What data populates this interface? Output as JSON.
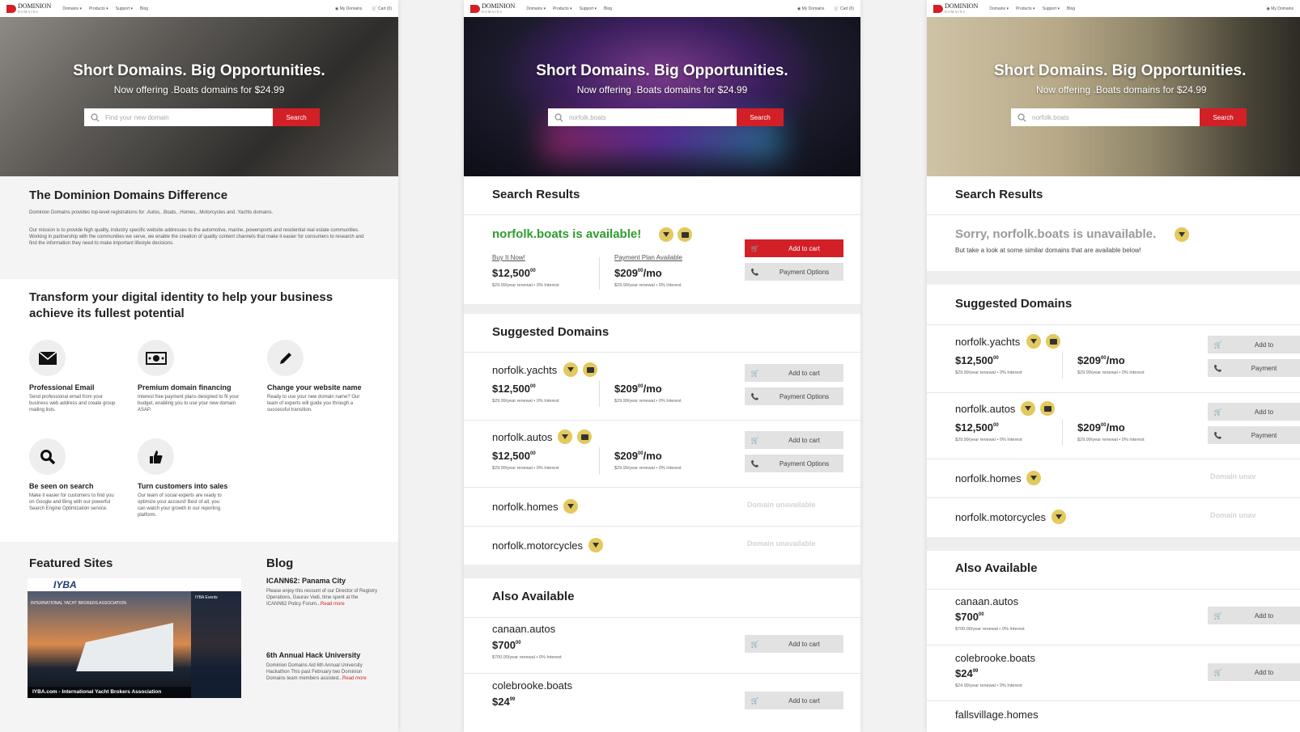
{
  "nav": {
    "brand": "DOMINION",
    "brand_sub": "DOMAINS",
    "links": [
      "Domains ▾",
      "Products ▾",
      "Support ▾",
      "Blog"
    ],
    "my_domains": "My Domains",
    "cart": "Cart (0)"
  },
  "hero": {
    "title": "Short Domains. Big Opportunities.",
    "subtitle": "Now offering .Boats domains for $24.99",
    "search_button": "Search"
  },
  "panel1": {
    "search_placeholder": "Find your new domain",
    "difference_title": "The Dominion Domains Difference",
    "difference_p1": "Dominion Domains provides top-level registrations for .Autos, .Boats, .Homes, .Motorcycles and .Yachts domains.",
    "difference_p2": "Our mission is to provide high quality, industry specific website addresses to the automotive, marine, powersports and residential real estate communities. Working in partnership with the communities we serve, we enable the creation of quality content channels that make it easier for consumers to research and find the information they need to make important lifestyle decisions.",
    "transform_title": "Transform your digital identity to help your business achieve its fullest potential",
    "features": [
      {
        "title": "Professional Email",
        "text": "Send professional email from your business web address and create group mailing lists."
      },
      {
        "title": "Premium domain financing",
        "text": "Interest free payment plans designed to fit your budget, enabling you to use your new domain ASAP."
      },
      {
        "title": "Change your website name",
        "text": "Ready to use your new domain name? Our team of experts will guide you through a successful transition."
      },
      {
        "title": "Be seen on search",
        "text": "Make it easier for customers to find you on Google and Bing with our powerful Search Engine Optimization service."
      },
      {
        "title": "Turn customers into sales",
        "text": "Our team of social experts are ready to optimize your account! Best of all, you can watch your growth in our reporting platform."
      }
    ],
    "featured_title": "Featured Sites",
    "featured_caption": "IYBA.com - International Yacht Brokers Association",
    "iyba_logo": "IYBA",
    "iyba_banner": "INTERNATIONAL YACHT BROKERS ASSOCIATION",
    "iyba_events": "IYBA Events",
    "blog_title": "Blog",
    "blog_posts": [
      {
        "title": "ICANN62: Panama City",
        "text": "Please enjoy this recount of our Director of Registry Operations, Gaurav Vedi, time spent at the ICANN62 Policy Forum...",
        "more": "Read more"
      },
      {
        "title": "6th Annual Hack University",
        "text": "Dominion Domains Aid 6th Annual University Hackathon This past February two Dominion Domains team members assisted...",
        "more": "Read more"
      }
    ]
  },
  "panel2": {
    "search_value": "norfolk.boats",
    "results_title": "Search Results",
    "available_text": "norfolk.boats is available!",
    "buy_label": "Buy It Now!",
    "buy_price": "$12,500",
    "buy_cents": "00",
    "buy_renewal": "$29.99/year renewal • 0% Interest",
    "plan_label": "Payment Plan Available",
    "plan_price": "$209",
    "plan_cents": "00",
    "plan_suffix": "/mo",
    "plan_renewal": "$29.99/year renewal • 0% Interest",
    "add_to_cart": "Add to cart",
    "payment_options": "Payment Options",
    "suggested_title": "Suggested Domains",
    "suggested": [
      {
        "name": "norfolk.yachts",
        "price": "$12,500",
        "cents": "00",
        "renewal": "$29.99/year renewal • 0% Interest",
        "mo": "$209",
        "mo_cents": "00",
        "mo_suffix": "/mo",
        "mo_renewal": "$29.99/year renewal • 0% Interest"
      },
      {
        "name": "norfolk.autos",
        "price": "$12,500",
        "cents": "00",
        "renewal": "$29.99/year renewal • 0% Interest",
        "mo": "$209",
        "mo_cents": "00",
        "mo_suffix": "/mo",
        "mo_renewal": "$29.99/year renewal • 0% Interest"
      },
      {
        "name": "norfolk.homes",
        "status": "Domain unavailable"
      },
      {
        "name": "norfolk.motorcycles",
        "status": "Domain unavailable"
      }
    ],
    "also_title": "Also Available",
    "also": [
      {
        "name": "canaan.autos",
        "price": "$700",
        "cents": "00",
        "renewal": "$700.00/year renewal • 0% Interest"
      },
      {
        "name": "colebrooke.boats",
        "price": "$24",
        "cents": "99",
        "renewal": "$24.99/year renewal • 0% Interest"
      }
    ]
  },
  "panel3": {
    "search_value": "norfolk.boats",
    "results_title": "Search Results",
    "unavailable_text": "Sorry, norfolk.boats is unavailable.",
    "unavailable_sub": "But take a look at some similar domains that are available below!",
    "suggested_title": "Suggested Domains",
    "suggested": [
      {
        "name": "norfolk.yachts",
        "price": "$12,500",
        "cents": "00",
        "renewal": "$29.99/year renewal • 0% Interest",
        "mo": "$209",
        "mo_cents": "00",
        "mo_suffix": "/mo",
        "mo_renewal": "$29.99/year renewal • 0% Interest",
        "add": "Add to",
        "pay": "Payment"
      },
      {
        "name": "norfolk.autos",
        "price": "$12,500",
        "cents": "00",
        "renewal": "$29.99/year renewal • 0% Interest",
        "mo": "$209",
        "mo_cents": "00",
        "mo_suffix": "/mo",
        "mo_renewal": "$29.99/year renewal • 0% Interest",
        "add": "Add to",
        "pay": "Payment"
      },
      {
        "name": "norfolk.homes",
        "status": "Domain unav"
      },
      {
        "name": "norfolk.motorcycles",
        "status": "Domain unav"
      }
    ],
    "also_title": "Also Available",
    "also": [
      {
        "name": "canaan.autos",
        "price": "$700",
        "cents": "00",
        "renewal": "$700.00/year renewal • 0% Interest",
        "add": "Add to"
      },
      {
        "name": "colebrooke.boats",
        "price": "$24",
        "cents": "99",
        "renewal": "$24.99/year renewal • 0% Interest",
        "add": "Add to"
      },
      {
        "name": "fallsvillage.homes"
      }
    ]
  },
  "colors": {
    "accent": "#d32027",
    "available": "#2e9d2e",
    "badge": "#e3c95e"
  }
}
